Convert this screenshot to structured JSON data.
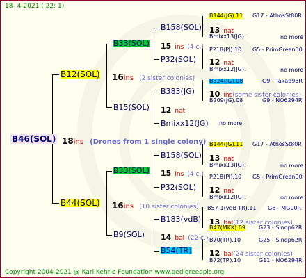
{
  "header": "18-   4-2021  ( 22:   1)",
  "footer": "Copyright 2004-2021 @ Karl Kehrle Foundation    www.pedigreeapis.org",
  "root": {
    "name": "B46(SOL)",
    "num": "18",
    "ins": "ins",
    "note": "(Drones from 1 single colony)"
  },
  "gen1": [
    {
      "name": "B12(SOL)",
      "num": "16",
      "ins": "ins",
      "note": "(2 sister colonies)"
    },
    {
      "name": "B44(SOL)",
      "num": "16",
      "ins": "ins",
      "note": "(10 sister colonies)"
    }
  ],
  "gen2": [
    {
      "name": "B33(SOL)",
      "num": "15",
      "ins": "ins",
      "note": "(4 c.)"
    },
    {
      "name": "B15(SOL)",
      "num": "12",
      "ins": "nat",
      "note": ""
    },
    {
      "name": "B33(SOL)",
      "num": "15",
      "ins": "ins",
      "note": "(4 c.)"
    },
    {
      "name": "B9(SOL)",
      "num": "14",
      "ins": "bal",
      "note": "(22 c.)"
    }
  ],
  "gen3": [
    {
      "name": "B158(SOL)",
      "num": "13",
      "ins": "nat",
      "note": ""
    },
    {
      "name": "P32(SOL)",
      "num": "12",
      "ins": "nat",
      "note": ""
    },
    {
      "name": "B383(JG)",
      "num": "10",
      "ins": "ins",
      "note": "(some sister colonies)"
    },
    {
      "name": "Bmixx12(JG)",
      "num": "",
      "ins": "",
      "note": "no more"
    },
    {
      "name": "B158(SOL)",
      "num": "13",
      "ins": "nat",
      "note": ""
    },
    {
      "name": "P32(SOL)",
      "num": "12",
      "ins": "nat",
      "note": ""
    },
    {
      "name": "B183(vdB)",
      "num": "13",
      "ins": "bal",
      "note": "(12 sister colonies)"
    },
    {
      "name": "B54(TR)",
      "num": "12",
      "ins": "bal",
      "note": "(24 sister colonies)"
    }
  ],
  "gen4": [
    {
      "name": "B144(JG).11",
      "code": "G17 - AthosSt80R"
    },
    {
      "name": "Bmixx13(JG).",
      "code": "no more"
    },
    {
      "name": "P218(PJ).10",
      "code": "G5 - PrimGreen00"
    },
    {
      "name": "Bmixx12(JG).",
      "code": "no more"
    },
    {
      "name": "B324(JG).08",
      "code": "G9 - Takab93R"
    },
    {
      "name": "B209(JG).08",
      "code": "G9 - NO6294R"
    },
    {
      "name": "B144(JG).11",
      "code": "G17 - AthosSt80R"
    },
    {
      "name": "Bmixx13(JG).",
      "code": "no more"
    },
    {
      "name": "P218(PJ).10",
      "code": "G5 - PrimGreen00"
    },
    {
      "name": "Bmixx12(JG).",
      "code": "no more"
    },
    {
      "name": "B57-1(vdB-TR).11",
      "code": "G8 - MG00R"
    },
    {
      "name": "B47(MKK).09",
      "code": "G23 - Sinop62R"
    },
    {
      "name": "B70(TR).10",
      "code": "G25 - Sinop62R"
    },
    {
      "name": "B72(TR).10",
      "code": "G11 - NO6294R"
    }
  ]
}
